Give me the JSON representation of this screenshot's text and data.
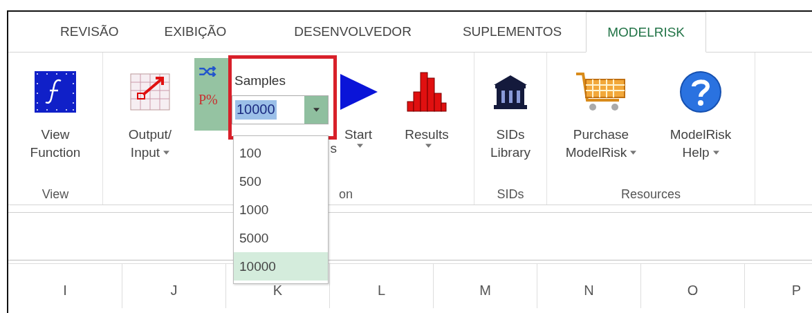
{
  "tabs": [
    {
      "label": "REVISÃO",
      "selected": false
    },
    {
      "label": "EXIBIÇÃO",
      "selected": false
    },
    {
      "label": "DESENVOLVEDOR",
      "selected": false
    },
    {
      "label": "SUPLEMENTOS",
      "selected": false
    },
    {
      "label": "MODELRISK",
      "selected": true
    }
  ],
  "ribbon": {
    "groups": [
      {
        "label": "View",
        "items": [
          {
            "kind": "function",
            "lines": [
              "View",
              "Function"
            ],
            "dropdown": false
          }
        ]
      },
      {
        "label": "on",
        "items": [
          {
            "kind": "output",
            "lines": [
              "Output/",
              "Input"
            ],
            "dropdown": true
          },
          {
            "kind": "samples"
          },
          {
            "kind": "start",
            "lines": [
              "Start"
            ],
            "dropdown": true
          },
          {
            "kind": "results",
            "lines": [
              "Results"
            ],
            "dropdown": true
          }
        ]
      },
      {
        "label": "SIDs",
        "items": [
          {
            "kind": "library",
            "lines": [
              "SIDs",
              "Library"
            ],
            "dropdown": false
          }
        ]
      },
      {
        "label": "Resources",
        "items": [
          {
            "kind": "cart",
            "lines": [
              "Purchase",
              "ModelRisk"
            ],
            "dropdown": true
          },
          {
            "kind": "help",
            "lines": [
              "ModelRisk",
              "Help"
            ],
            "dropdown": true
          }
        ]
      }
    ]
  },
  "samples": {
    "side_label": "P%",
    "label": "Samples",
    "value": "10000",
    "partial_label": "s",
    "expanded": true,
    "options": [
      {
        "label": "100",
        "selected": false
      },
      {
        "label": "500",
        "selected": false
      },
      {
        "label": "1000",
        "selected": false
      },
      {
        "label": "5000",
        "selected": false
      },
      {
        "label": "10000",
        "selected": true
      }
    ]
  },
  "columns": [
    "I",
    "J",
    "K",
    "L",
    "M",
    "N",
    "O",
    "P"
  ]
}
